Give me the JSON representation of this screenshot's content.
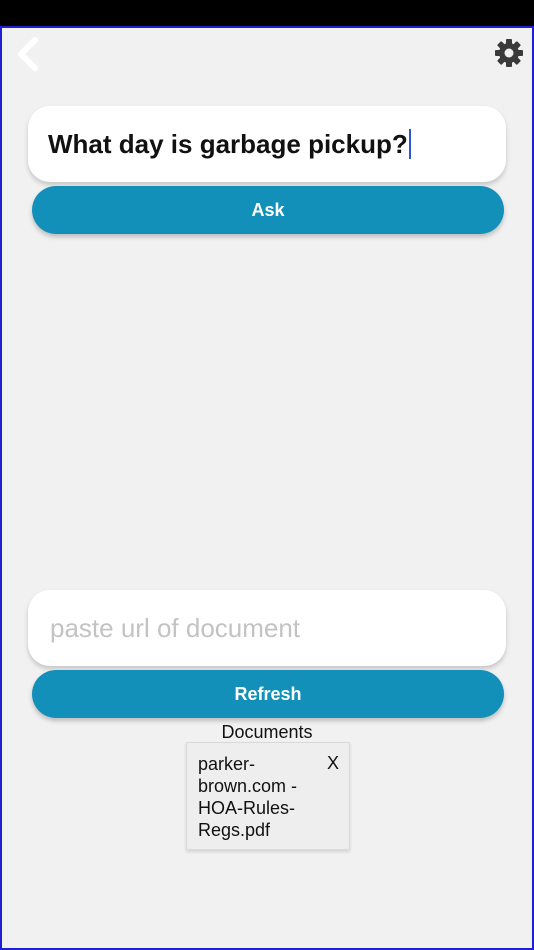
{
  "header": {
    "back_icon": "chevron-left-icon",
    "settings_icon": "gear-icon"
  },
  "question": {
    "value": "What day is garbage pickup?",
    "ask_label": "Ask"
  },
  "document_url": {
    "placeholder": "paste url of document",
    "value": "",
    "refresh_label": "Refresh"
  },
  "documents": {
    "title": "Documents",
    "items": [
      {
        "name": "parker-brown.com - HOA-Rules-Regs.pdf",
        "remove_label": "X"
      }
    ]
  },
  "colors": {
    "accent": "#1290ba",
    "background": "#f1f1f1",
    "border": "#1f1fd6"
  }
}
